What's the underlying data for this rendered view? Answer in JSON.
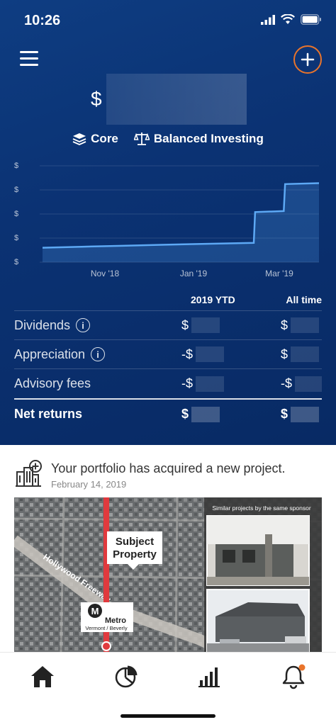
{
  "status_bar": {
    "time": "10:26"
  },
  "header": {
    "balance_prefix": "$"
  },
  "tags": [
    {
      "icon": "layers-icon",
      "label": "Core"
    },
    {
      "icon": "scale-icon",
      "label": "Balanced Investing"
    }
  ],
  "chart_data": {
    "type": "area",
    "x_ticks": [
      "Nov '18",
      "Jan '19",
      "Mar '19"
    ],
    "y_ticks": [
      "$",
      "$",
      "$",
      "$",
      "$"
    ],
    "series": [
      {
        "values": [
          [
            "2018-09",
            0.15
          ],
          [
            "2018-10",
            0.16
          ],
          [
            "2018-11",
            0.17
          ],
          [
            "2018-12",
            0.18
          ],
          [
            "2019-01",
            0.19
          ],
          [
            "2019-02-10",
            0.2
          ],
          [
            "2019-02-11",
            0.52
          ],
          [
            "2019-03-05",
            0.53
          ],
          [
            "2019-03-06",
            0.81
          ],
          [
            "2019-04",
            0.82
          ]
        ]
      }
    ],
    "color": "#5da9f5"
  },
  "returns_table": {
    "headers": [
      "2019 YTD",
      "All time"
    ],
    "rows": [
      {
        "label": "Dividends",
        "info": true,
        "ytd": "$",
        "all": "$"
      },
      {
        "label": "Appreciation",
        "info": true,
        "ytd": "-$",
        "all": "$"
      },
      {
        "label": "Advisory fees",
        "info": false,
        "ytd": "-$",
        "all": "-$"
      },
      {
        "label": "Net returns",
        "info": false,
        "ytd": "$",
        "all": "$"
      }
    ],
    "info_glyph": "i"
  },
  "feed_card": {
    "title": "Your portfolio has acquired a new project.",
    "date": "February 14, 2019",
    "map_labels": {
      "subject_line1": "Subject",
      "subject_line2": "Property",
      "freeway": "Hollywood Freeway",
      "metro": "Metro",
      "metro_sub": "Vermont / Beverly",
      "metro_glyph": "M",
      "similar": "Similar projects by the same sponsor"
    }
  },
  "tabbar": {
    "items": [
      "home-icon",
      "pie-chart-icon",
      "bar-chart-icon",
      "bell-icon"
    ],
    "notification_color": "#e9742b"
  },
  "colors": {
    "accent": "#e9742b",
    "hero_bg": "#0b3273",
    "chart_line": "#5da9f5"
  }
}
